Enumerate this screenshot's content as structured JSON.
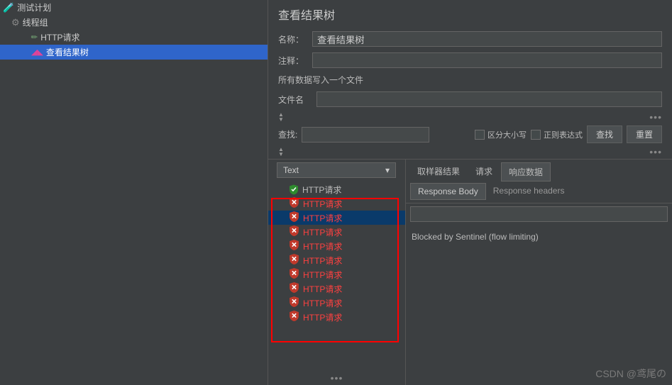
{
  "tree": {
    "root": "测试计划",
    "threadGroup": "线程组",
    "httpRequest": "HTTP请求",
    "viewResults": "查看结果树"
  },
  "panel": {
    "title": "查看结果树",
    "nameLabel": "名称：",
    "nameValue": "查看结果树",
    "commentLabel": "注释：",
    "writeAll": "所有数据写入一个文件",
    "filenameLabel": "文件名"
  },
  "search": {
    "label": "查找:",
    "caseSensitive": "区分大小写",
    "regex": "正则表达式",
    "findBtn": "查找",
    "resetBtn": "重置"
  },
  "renderer": {
    "selected": "Text"
  },
  "results": [
    {
      "label": "HTTP请求",
      "status": "ok"
    },
    {
      "label": "HTTP请求",
      "status": "err"
    },
    {
      "label": "HTTP请求",
      "status": "err",
      "selected": true
    },
    {
      "label": "HTTP请求",
      "status": "err"
    },
    {
      "label": "HTTP请求",
      "status": "err"
    },
    {
      "label": "HTTP请求",
      "status": "err"
    },
    {
      "label": "HTTP请求",
      "status": "err"
    },
    {
      "label": "HTTP请求",
      "status": "err"
    },
    {
      "label": "HTTP请求",
      "status": "err"
    },
    {
      "label": "HTTP请求",
      "status": "err"
    }
  ],
  "tabs": {
    "sampler": "取样器结果",
    "request": "请求",
    "response": "响应数据"
  },
  "subtabs": {
    "body": "Response Body",
    "headers": "Response headers"
  },
  "response": {
    "body": "Blocked by Sentinel (flow limiting)"
  },
  "watermark": "CSDN @鸢尾の"
}
